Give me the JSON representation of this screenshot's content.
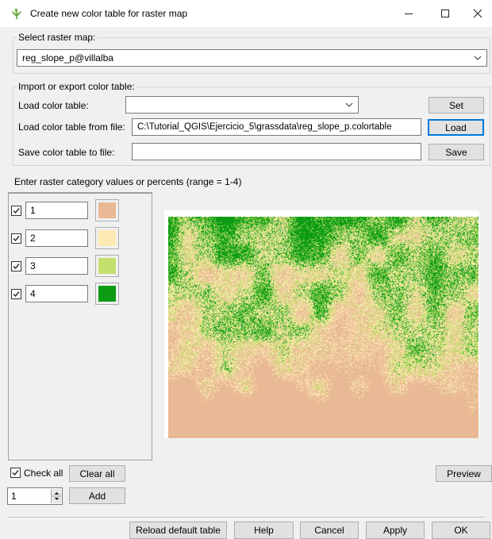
{
  "window": {
    "title": "Create new color table for raster map",
    "minimize_icon": "minimize-icon",
    "maximize_icon": "maximize-icon",
    "close_icon": "close-icon"
  },
  "raster_group": {
    "label": "Select raster map:",
    "value": "reg_slope_p@villalba"
  },
  "import_group": {
    "label": "Import or export color table:",
    "load_color_table_label": "Load color table:",
    "load_color_table_value": "",
    "set_button": "Set",
    "load_from_file_label": "Load color table from file:",
    "load_from_file_value": "C:\\Tutorial_QGIS\\Ejercicio_5\\grassdata\\reg_slope_p.colortable",
    "load_button": "Load",
    "save_to_file_label": "Save color table to file:",
    "save_to_file_value": "",
    "save_button": "Save"
  },
  "rules": {
    "instruction": "Enter raster category values or percents (range = 1-4)",
    "rows": [
      {
        "checked": true,
        "value": "1",
        "color": "#e8b994"
      },
      {
        "checked": true,
        "value": "2",
        "color": "#fde9b2"
      },
      {
        "checked": true,
        "value": "3",
        "color": "#c4e06c"
      },
      {
        "checked": true,
        "value": "4",
        "color": "#0c9c14"
      }
    ]
  },
  "controls": {
    "check_all_label": "Check all",
    "check_all_checked": true,
    "clear_all_button": "Clear all",
    "spin_value": "1",
    "add_button": "Add",
    "preview_button": "Preview"
  },
  "footer": {
    "reload_button": "Reload default table",
    "help_button": "Help",
    "cancel_button": "Cancel",
    "apply_button": "Apply",
    "ok_button": "OK"
  },
  "preview_palette": [
    "#e8b994",
    "#fde9b2",
    "#c4e06c",
    "#0c9c14"
  ]
}
